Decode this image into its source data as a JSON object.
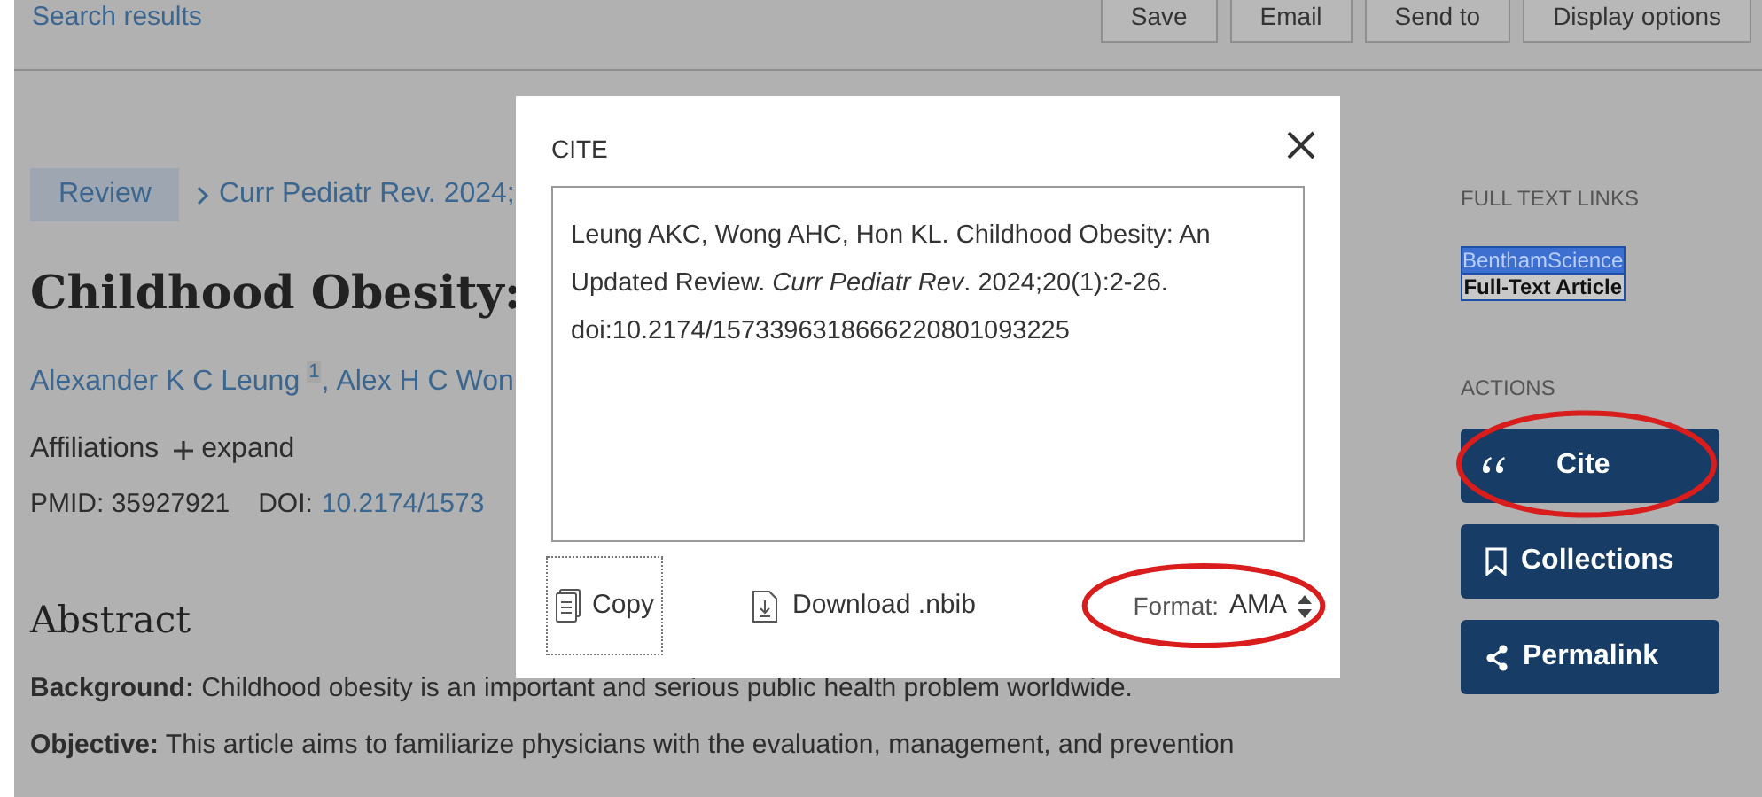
{
  "top_bar": {
    "back_link": "Search results",
    "buttons": [
      "Save",
      "Email",
      "Send to",
      "Display options"
    ]
  },
  "article": {
    "type_badge": "Review",
    "journal": "Curr Pediatr Rev. 2024;",
    "title": "Childhood Obesity:",
    "authors": [
      {
        "name": "Alexander K C Leung",
        "affiliation": "1"
      },
      {
        "separator": ",",
        "name": "Alex H C Won"
      }
    ],
    "affiliations_label": "Affiliations",
    "expand": "expand",
    "pmid": "PMID: 35927921",
    "doi_label": "DOI:",
    "doi": "10.2174/1573",
    "abstract_heading": "Abstract",
    "paragraphs": [
      "**Background:** Childhood obesity is an important and serious public health problem worldwide.",
      "**Objective:** This article aims to familiarize physicians with the evaluation, management, and prevention"
    ]
  },
  "sidebar": {
    "full_text_heading": "FULL TEXT LINKS",
    "publisher_logo": [
      "BenthamScience",
      "Full-Text Article"
    ],
    "actions_heading": "ACTIONS",
    "actions": [
      {
        "kind": "cite",
        "label": "Cite",
        "circled": true
      },
      {
        "kind": "collections",
        "label": "Collections",
        "circled": false
      },
      {
        "kind": "permalink",
        "label": "Permalink",
        "circled": false
      }
    ]
  },
  "cite_dialog": {
    "title": "CITE",
    "citation": "Leung AKC, Wong AHC, Hon KL. Childhood Obesity: An Updated Review. *Curr Pediatr Rev*. 2024;20(1):2-26. doi:10.2174/1573396318666220801093225",
    "copy": "Copy",
    "download": "Download .nbib",
    "format_label": "Format:",
    "format_value": "AMA",
    "format_circled": true
  }
}
